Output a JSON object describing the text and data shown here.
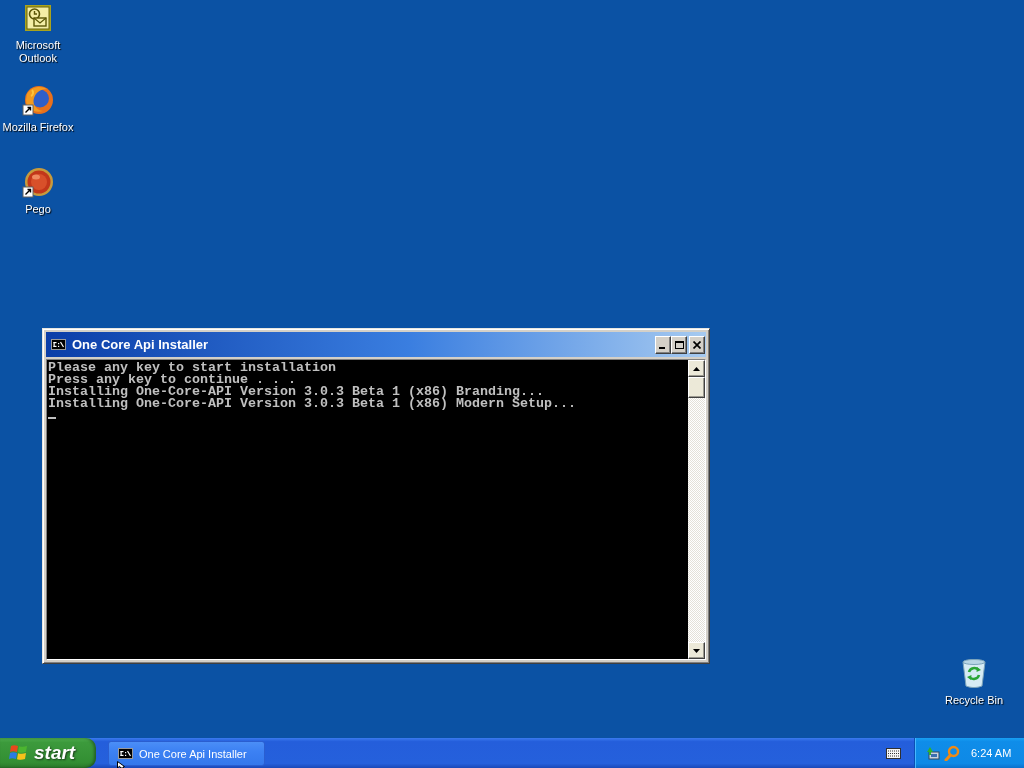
{
  "desktop_icons": [
    {
      "kind": "mail",
      "label": "Microsoft Outlook",
      "shortcut": false
    },
    {
      "kind": "browser",
      "label": "Mozilla Firefox",
      "shortcut": true
    },
    {
      "kind": "orb",
      "label": "Pego",
      "shortcut": true
    }
  ],
  "recycle_bin": {
    "label": "Recycle Bin"
  },
  "window": {
    "title": "One Core Api Installer",
    "active": true,
    "console_lines": [
      "Please any key to start installation",
      "Press any key to continue . . .",
      "Installing One-Core-API Version 3.0.3 Beta 1 (x86) Branding...",
      "Installing One-Core-API Version 3.0.3 Beta 1 (x86) Modern Setup..."
    ],
    "cursor": true
  },
  "taskbar": {
    "start_label": "start",
    "buttons": [
      {
        "label": "One Core Api Installer"
      }
    ],
    "clock": "6:24 AM"
  }
}
